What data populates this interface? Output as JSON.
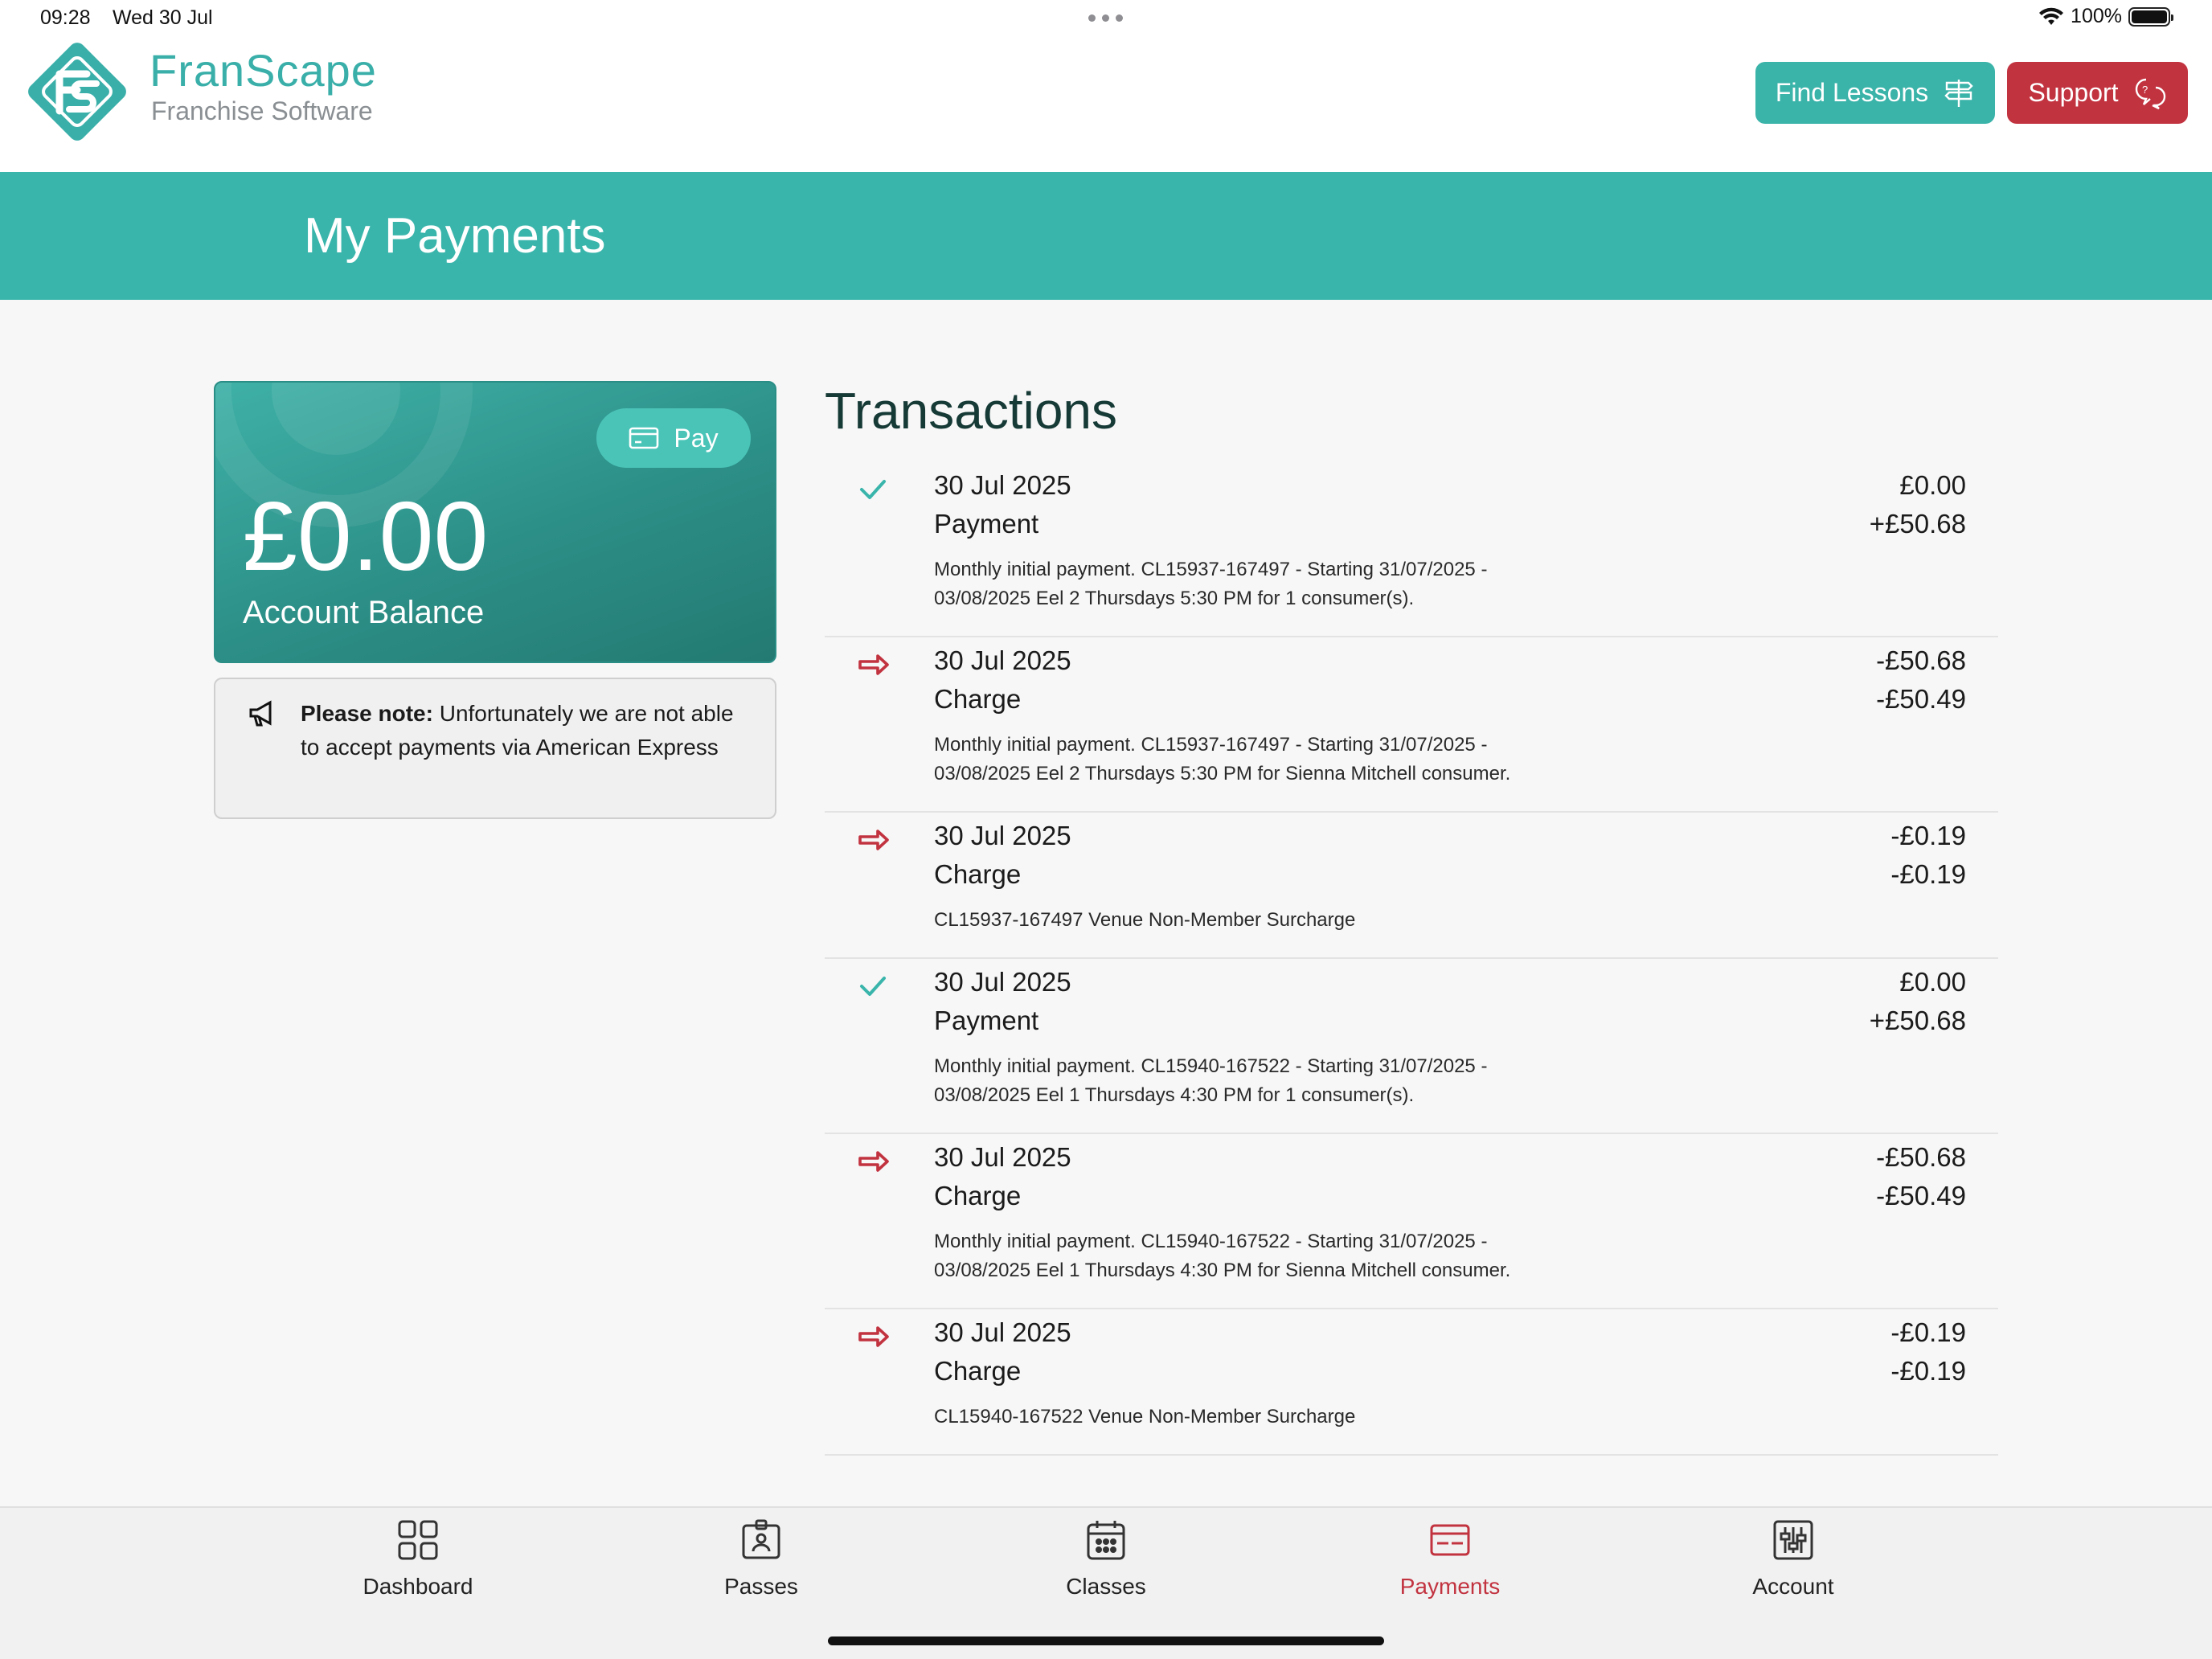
{
  "status_bar": {
    "time": "09:28",
    "date": "Wed 30 Jul",
    "battery": "100%"
  },
  "brand": {
    "name": "FranScape",
    "tagline": "Franchise Software",
    "color": "#3aafa9"
  },
  "header": {
    "find_lessons": "Find Lessons",
    "support": "Support"
  },
  "page": {
    "title": "My Payments"
  },
  "balance": {
    "pay_label": "Pay",
    "amount": "£0.00",
    "label": "Account Balance"
  },
  "notice": {
    "bold": "Please note:",
    "text": " Unfortunately we are not able to accept payments via American Express"
  },
  "transactions": {
    "title": "Transactions",
    "items": [
      {
        "status": "payment",
        "date": "30 Jul 2025",
        "type": "Payment",
        "amount": "£0.00",
        "change": "+£50.68",
        "line1": "Monthly initial payment. CL15937-167497 - Starting 31/07/2025 -",
        "line2": "03/08/2025 Eel 2 Thursdays 5:30 PM for 1 consumer(s)."
      },
      {
        "status": "charge",
        "date": "30 Jul 2025",
        "type": "Charge",
        "amount": "-£50.68",
        "change": "-£50.49",
        "line1": "Monthly initial payment. CL15937-167497 - Starting 31/07/2025 -",
        "line2": "03/08/2025 Eel 2 Thursdays 5:30 PM for Sienna Mitchell consumer."
      },
      {
        "status": "charge",
        "date": "30 Jul 2025",
        "type": "Charge",
        "amount": "-£0.19",
        "change": "-£0.19",
        "line1": "CL15937-167497 Venue Non-Member Surcharge",
        "line2": ""
      },
      {
        "status": "payment",
        "date": "30 Jul 2025",
        "type": "Payment",
        "amount": "£0.00",
        "change": "+£50.68",
        "line1": "Monthly initial payment. CL15940-167522 - Starting 31/07/2025 -",
        "line2": "03/08/2025 Eel 1 Thursdays 4:30 PM for 1 consumer(s)."
      },
      {
        "status": "charge",
        "date": "30 Jul 2025",
        "type": "Charge",
        "amount": "-£50.68",
        "change": "-£50.49",
        "line1": "Monthly initial payment. CL15940-167522 - Starting 31/07/2025 -",
        "line2": "03/08/2025 Eel 1 Thursdays 4:30 PM for Sienna Mitchell consumer."
      },
      {
        "status": "charge",
        "date": "30 Jul 2025",
        "type": "Charge",
        "amount": "-£0.19",
        "change": "-£0.19",
        "line1": "CL15940-167522 Venue Non-Member Surcharge",
        "line2": ""
      }
    ]
  },
  "nav": {
    "dashboard": "Dashboard",
    "passes": "Passes",
    "classes": "Classes",
    "payments": "Payments",
    "account": "Account",
    "active": "payments"
  },
  "colors": {
    "teal": "#3ab5ab",
    "red": "#c23340",
    "dark_teal": "#163a36"
  }
}
